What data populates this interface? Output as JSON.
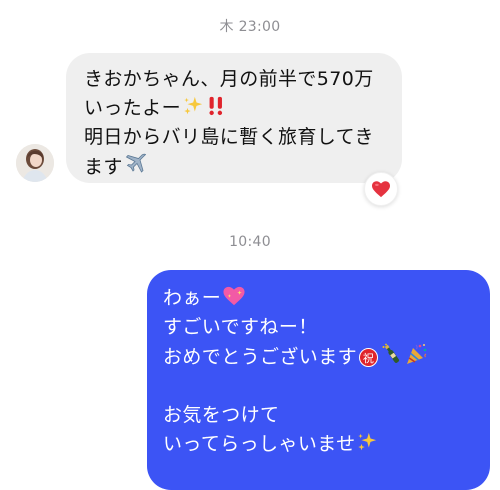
{
  "timestamps": {
    "first": "木 23:00",
    "second": "10:40"
  },
  "incoming": {
    "line1": "きおかちゃん、月の前半で570万",
    "line2": "いったよー",
    "line3": "明日からバリ島に暫く旅育してき",
    "line4": "ます",
    "line2_emoji": [
      "sparkles-icon",
      "double-exclamation-icon"
    ],
    "line4_emoji": [
      "airplane-icon"
    ],
    "reaction": "heart-icon"
  },
  "outgoing": {
    "line1": "わぁー",
    "line2": "すごいですねー！",
    "line3": "おめでとうございます",
    "line3_badge": "祝",
    "line5": "お気をつけて",
    "line6": "いってらっしゃいませ",
    "line1_emoji": [
      "sparkling-heart-icon"
    ],
    "line3_emoji": [
      "congratulations-icon",
      "champagne-icon",
      "party-popper-icon"
    ],
    "line6_emoji": [
      "sparkles-icon"
    ]
  },
  "colors": {
    "incoming_bubble": "#efefef",
    "outgoing_bubble": "#3c54f5",
    "timestamp_text": "#8e8e93",
    "heart": "#e53340"
  }
}
